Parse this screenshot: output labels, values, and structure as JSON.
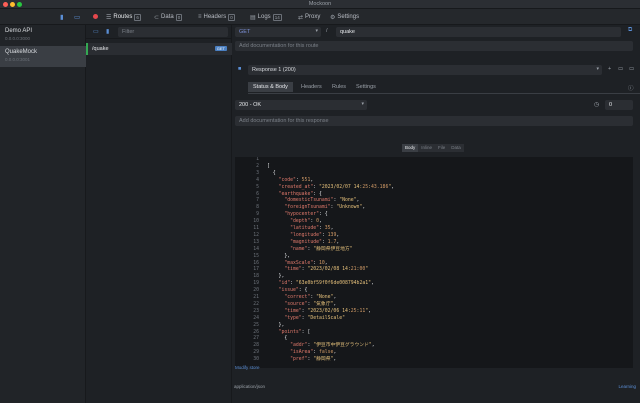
{
  "window": {
    "title": "Mockoon"
  },
  "toolbar": {
    "tabs": [
      {
        "label": "Routes",
        "count": "6"
      },
      {
        "label": "Data",
        "count": "0"
      },
      {
        "label": "Headers",
        "count": "0"
      },
      {
        "label": "Logs",
        "count": "14"
      },
      {
        "label": "Proxy"
      },
      {
        "label": "Settings"
      }
    ]
  },
  "environments": [
    {
      "name": "Demo API",
      "sub": "0.0.0.0:3000"
    },
    {
      "name": "QuakeMock",
      "sub": "0.0.0.0:3001"
    }
  ],
  "routes": {
    "filter_placeholder": "Filter",
    "items": [
      {
        "path": "/quake",
        "method": "GET"
      }
    ]
  },
  "route": {
    "method": "GET",
    "path": "quake",
    "doc_placeholder": "Add documentation for this route"
  },
  "response": {
    "name": "Response 1 (200)",
    "tabs": [
      "Status & Body",
      "Headers",
      "Rules",
      "Settings"
    ],
    "status": "200 - OK",
    "latency": "0",
    "doc_placeholder": "Add documentation for this response",
    "body_types": [
      "Body",
      "Inline",
      "File",
      "Data"
    ]
  },
  "editor": {
    "lines": [
      {
        "n": "1",
        "text": ""
      },
      {
        "n": "2",
        "text": "["
      },
      {
        "n": "3",
        "text": "  {"
      },
      {
        "n": "4",
        "text": "    \"code\": 551,"
      },
      {
        "n": "5",
        "text": "    \"created_at\": \"2023/02/07 14:25:43.186\","
      },
      {
        "n": "6",
        "text": "    \"earthquake\": {"
      },
      {
        "n": "7",
        "text": "      \"domesticTsunami\": \"None\","
      },
      {
        "n": "8",
        "text": "      \"foreignTsunami\": \"Unknown\","
      },
      {
        "n": "9",
        "text": "      \"hypocenter\": {"
      },
      {
        "n": "10",
        "text": "        \"depth\": 0,"
      },
      {
        "n": "11",
        "text": "        \"latitude\": 35,"
      },
      {
        "n": "12",
        "text": "        \"longitude\": 139,"
      },
      {
        "n": "13",
        "text": "        \"magnitude\": 1.7,"
      },
      {
        "n": "14",
        "text": "        \"name\": \"静岡県伊豆地方\""
      },
      {
        "n": "15",
        "text": "      },"
      },
      {
        "n": "16",
        "text": "      \"maxScale\": 10,"
      },
      {
        "n": "17",
        "text": "      \"time\": \"2023/02/08 14:21:00\""
      },
      {
        "n": "18",
        "text": "    },"
      },
      {
        "n": "19",
        "text": "    \"id\": \"63e0bf59f0f6de008794b2a1\","
      },
      {
        "n": "20",
        "text": "    \"issue\": {"
      },
      {
        "n": "21",
        "text": "      \"correct\": \"None\","
      },
      {
        "n": "22",
        "text": "      \"source\": \"気象庁\","
      },
      {
        "n": "23",
        "text": "      \"time\": \"2023/02/06 14:25:11\","
      },
      {
        "n": "24",
        "text": "      \"type\": \"DetailScale\""
      },
      {
        "n": "25",
        "text": "    },"
      },
      {
        "n": "26",
        "text": "    \"points\": ["
      },
      {
        "n": "27",
        "text": "      {"
      },
      {
        "n": "28",
        "text": "        \"addr\": \"伊豆市中伊豆グラウンド\","
      },
      {
        "n": "29",
        "text": "        \"isArea\": false,"
      },
      {
        "n": "30",
        "text": "        \"pref\": \"静岡県\","
      }
    ],
    "footer_link": "Modify store"
  },
  "footer": {
    "content_type": "application/json",
    "link": "Learning"
  }
}
